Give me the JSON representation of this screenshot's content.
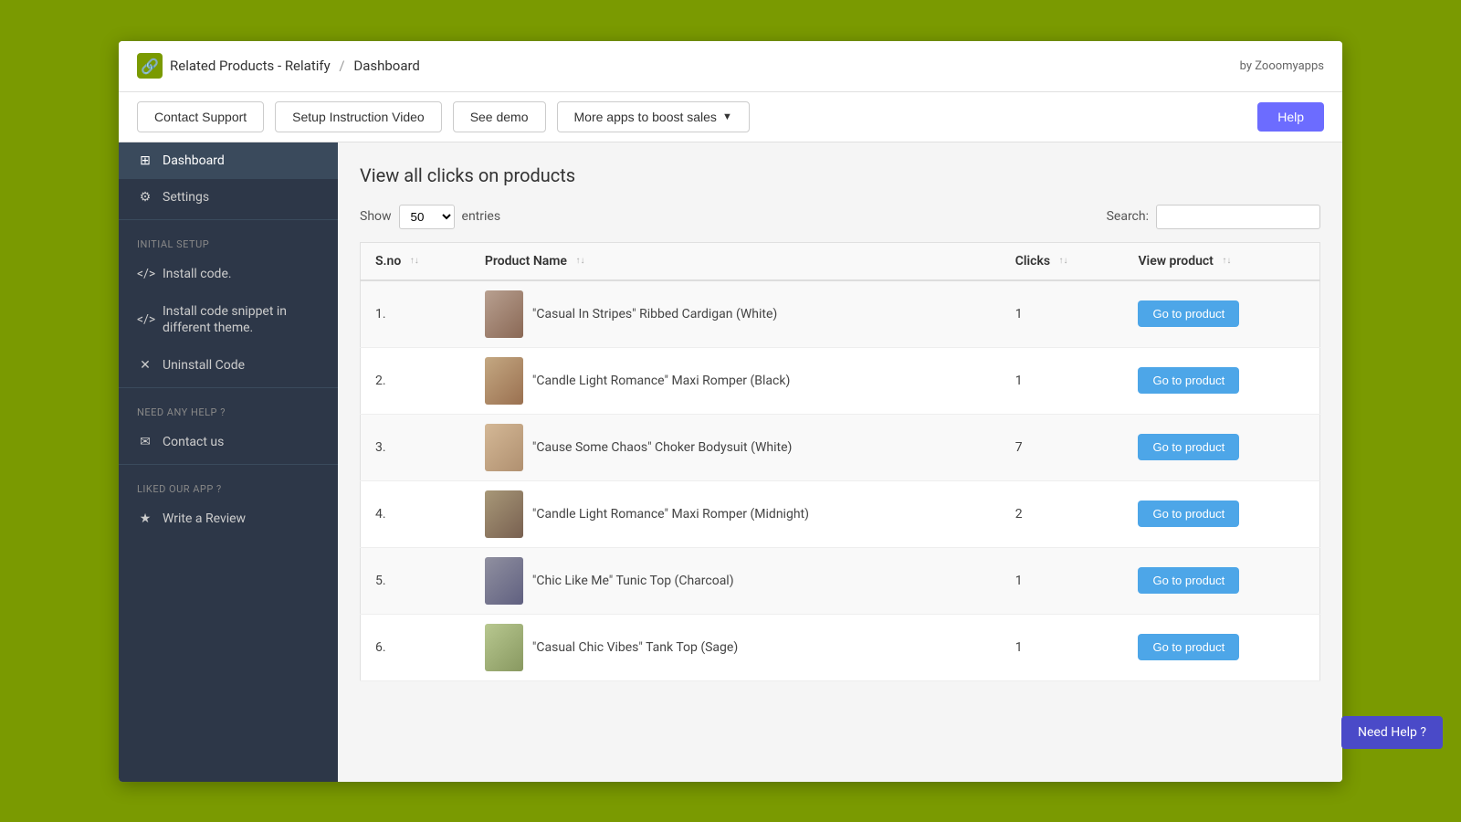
{
  "header": {
    "logo_icon": "🔗",
    "app_name": "Related Products - Relatify",
    "separator": "/",
    "page_name": "Dashboard",
    "by_label": "by Zooomyapps"
  },
  "toolbar": {
    "contact_support": "Contact Support",
    "setup_video": "Setup Instruction Video",
    "see_demo": "See demo",
    "more_apps": "More apps to boost sales",
    "help": "Help"
  },
  "sidebar": {
    "dashboard_label": "Dashboard",
    "settings_label": "Settings",
    "initial_setup_title": "INITIAL SETUP",
    "install_code_label": "Install code.",
    "install_snippet_label": "Install code snippet in different theme.",
    "uninstall_label": "Uninstall Code",
    "need_help_title": "NEED ANY HELP ?",
    "contact_us_label": "Contact us",
    "liked_app_title": "LIKED OUR APP ?",
    "write_review_label": "Write a Review"
  },
  "content": {
    "page_title": "View all clicks on products",
    "show_label": "Show",
    "entries_label": "entries",
    "search_label": "Search:",
    "show_value": "50"
  },
  "table": {
    "columns": [
      {
        "key": "sno",
        "label": "S.no",
        "sortable": true
      },
      {
        "key": "product_name",
        "label": "Product Name",
        "sortable": true
      },
      {
        "key": "clicks",
        "label": "Clicks",
        "sortable": true
      },
      {
        "key": "view_product",
        "label": "View product",
        "sortable": true
      }
    ],
    "rows": [
      {
        "sno": "1.",
        "name": "\"Casual In Stripes\" Ribbed Cardigan (White)",
        "clicks": "1",
        "btn": "Go to product"
      },
      {
        "sno": "2.",
        "name": "\"Candle Light Romance\" Maxi Romper (Black)",
        "clicks": "1",
        "btn": "Go to product"
      },
      {
        "sno": "3.",
        "name": "\"Cause Some Chaos\" Choker Bodysuit (White)",
        "clicks": "7",
        "btn": "Go to product"
      },
      {
        "sno": "4.",
        "name": "\"Candle Light Romance\" Maxi Romper (Midnight)",
        "clicks": "2",
        "btn": "Go to product"
      },
      {
        "sno": "5.",
        "name": "\"Chic Like Me\" Tunic Top (Charcoal)",
        "clicks": "1",
        "btn": "Go to product"
      },
      {
        "sno": "6.",
        "name": "\"Casual Chic Vibes\" Tank Top (Sage)",
        "clicks": "1",
        "btn": "Go to product"
      }
    ]
  },
  "need_help_label": "Need Help ?"
}
